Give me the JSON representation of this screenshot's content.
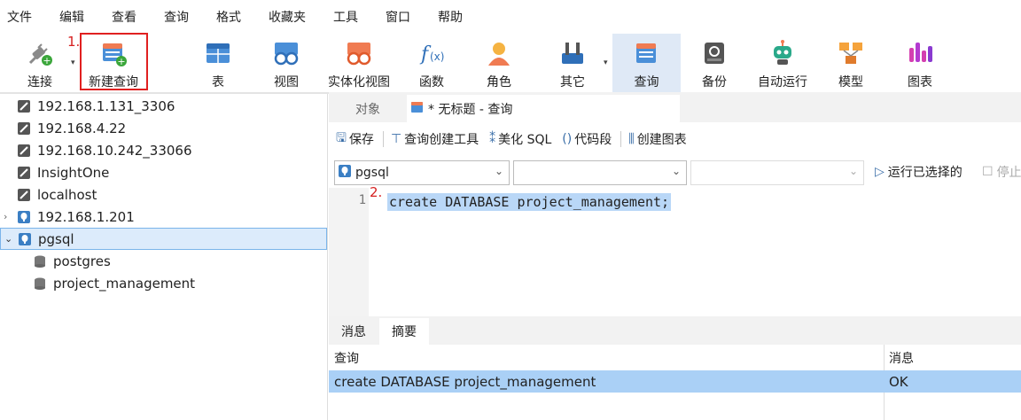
{
  "menu": [
    "文件",
    "编辑",
    "查看",
    "查询",
    "格式",
    "收藏夹",
    "工具",
    "窗口",
    "帮助"
  ],
  "toolbar": {
    "items": [
      {
        "label": "连接",
        "icon": "plug-icon"
      },
      {
        "label": "新建查询",
        "icon": "new-query-icon"
      },
      {
        "label": "表",
        "icon": "table-icon"
      },
      {
        "label": "视图",
        "icon": "view-icon"
      },
      {
        "label": "实体化视图",
        "icon": "materialized-view-icon"
      },
      {
        "label": "函数",
        "icon": "function-icon"
      },
      {
        "label": "角色",
        "icon": "user-role-icon"
      },
      {
        "label": "其它",
        "icon": "tools-icon"
      },
      {
        "label": "查询",
        "icon": "query-icon"
      },
      {
        "label": "备份",
        "icon": "backup-icon"
      },
      {
        "label": "自动运行",
        "icon": "robot-icon"
      },
      {
        "label": "模型",
        "icon": "model-icon"
      },
      {
        "label": "图表",
        "icon": "chart-icon"
      }
    ],
    "selected": "查询",
    "annotation1": "1.",
    "annotation2": "2."
  },
  "tree": {
    "connections": [
      {
        "label": "192.168.1.131_3306",
        "icon": "mysql-connection-icon"
      },
      {
        "label": "192.168.4.22",
        "icon": "mysql-connection-icon"
      },
      {
        "label": "192.168.10.242_33066",
        "icon": "mysql-connection-icon"
      },
      {
        "label": "InsightOne",
        "icon": "mysql-connection-icon"
      },
      {
        "label": "localhost",
        "icon": "mysql-connection-icon"
      },
      {
        "label": "192.168.1.201",
        "icon": "postgres-connection-icon"
      },
      {
        "label": "pgsql",
        "icon": "postgres-connection-icon"
      }
    ],
    "databases": [
      {
        "label": "postgres",
        "icon": "database-icon"
      },
      {
        "label": "project_management",
        "icon": "database-icon"
      }
    ]
  },
  "tabs": {
    "objects": "对象",
    "query_tab": "* 无标题 - 查询"
  },
  "editor_tools": {
    "save": "保存",
    "builder": "查询创建工具",
    "beautify": "美化 SQL",
    "snippet": "代码段",
    "create_chart": "创建图表"
  },
  "selectors": {
    "connection": "pgsql",
    "database": "",
    "schema": "",
    "run_selected": "运行已选择的",
    "stop": "停止"
  },
  "code": {
    "line_number": "1",
    "text": "create DATABASE project_management;"
  },
  "messages": {
    "tab_messages": "消息",
    "tab_summary": "摘要",
    "col_query": "查询",
    "col_message": "消息",
    "row_query": "create DATABASE project_management",
    "row_message": "OK"
  },
  "colors": {
    "selected_toolbar": "#dfe9f6",
    "result_row": "#aad0f6",
    "annotation_red": "#e02020",
    "mysql_icon": "#555555",
    "postgres_icon": "#3b7fc4"
  }
}
